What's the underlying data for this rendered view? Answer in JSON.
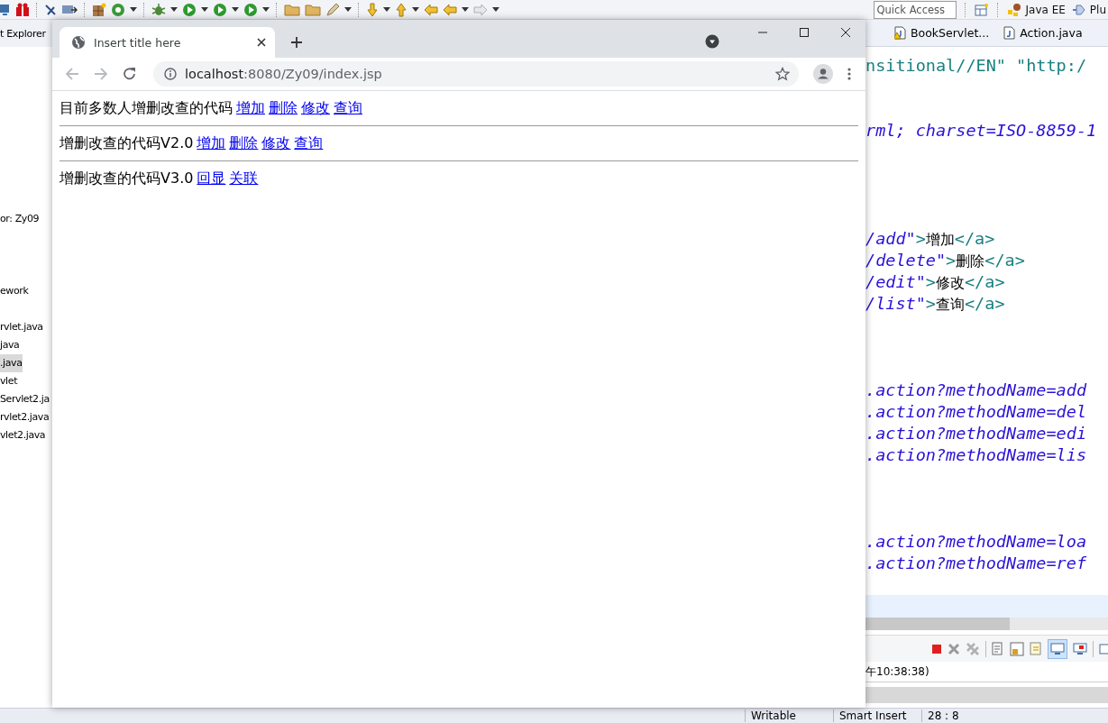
{
  "ide": {
    "quick_access": {
      "placeholder": "Quick Access"
    },
    "perspectives": [
      {
        "label": "Java EE",
        "kind": "javaee"
      },
      {
        "label": "Plu",
        "kind": "plugin"
      }
    ],
    "explorer": {
      "title": "t Explorer",
      "labels": [
        "or: Zy09",
        "ework"
      ],
      "items": [
        {
          "label": "rvlet.java",
          "selected": false
        },
        {
          "label": "java",
          "selected": false
        },
        {
          "label": ".java",
          "selected": true
        },
        {
          "label": "vlet",
          "selected": false
        },
        {
          "label": "Servlet2.ja",
          "selected": false
        },
        {
          "label": "rvlet2.java",
          "selected": false
        },
        {
          "label": "vlet2.java",
          "selected": false
        }
      ]
    },
    "editor_tabs": [
      {
        "label": "BookServlet...",
        "warning": true
      },
      {
        "label": "Action.java",
        "warning": false
      }
    ],
    "code_blocks": [
      [
        [
          {
            "kind": "tag",
            "text": "nsitional//EN\" \"http:/"
          }
        ]
      ],
      [
        [
          {
            "kind": "value",
            "text": "rml; charset=ISO-8859-1"
          }
        ]
      ],
      [
        [
          {
            "kind": "value",
            "text": "/add\""
          },
          {
            "kind": "tag",
            "text": ">"
          },
          {
            "kind": "text",
            "text": "增加"
          },
          {
            "kind": "tag",
            "text": "</a>"
          }
        ],
        [
          {
            "kind": "value",
            "text": "/delete\""
          },
          {
            "kind": "tag",
            "text": ">"
          },
          {
            "kind": "text",
            "text": "删除"
          },
          {
            "kind": "tag",
            "text": "</a>"
          }
        ],
        [
          {
            "kind": "value",
            "text": "/edit\""
          },
          {
            "kind": "tag",
            "text": ">"
          },
          {
            "kind": "text",
            "text": "修改"
          },
          {
            "kind": "tag",
            "text": "</a>"
          }
        ],
        [
          {
            "kind": "value",
            "text": "/list\""
          },
          {
            "kind": "tag",
            "text": ">"
          },
          {
            "kind": "text",
            "text": "查询"
          },
          {
            "kind": "tag",
            "text": "</a>"
          }
        ]
      ],
      [
        [
          {
            "kind": "value",
            "text": ".action?methodName=add"
          }
        ],
        [
          {
            "kind": "value",
            "text": ".action?methodName=del"
          }
        ],
        [
          {
            "kind": "value",
            "text": ".action?methodName=edi"
          }
        ],
        [
          {
            "kind": "value",
            "text": ".action?methodName=lis"
          }
        ]
      ],
      [
        [
          {
            "kind": "value",
            "text": ".action?methodName=loa"
          }
        ],
        [
          {
            "kind": "value",
            "text": ".action?methodName=ref"
          }
        ]
      ]
    ],
    "console_text": "午10:38:38)",
    "status_bar": [
      "Writable",
      "Smart Insert",
      "28 : 8"
    ]
  },
  "browser": {
    "tab_title": "Insert title here",
    "url_host": "localhost",
    "url_path": ":8080/Zy09/index.jsp",
    "sections": [
      {
        "text": "目前多数人增删改查的代码",
        "links": [
          "增加",
          "删除",
          "修改",
          "查询"
        ]
      },
      {
        "text": "增删改查的代码V2.0",
        "links": [
          "增加",
          "删除",
          "修改",
          "查询"
        ]
      },
      {
        "text": "增删改查的代码V3.0",
        "links": [
          "回显",
          "关联"
        ]
      }
    ]
  }
}
